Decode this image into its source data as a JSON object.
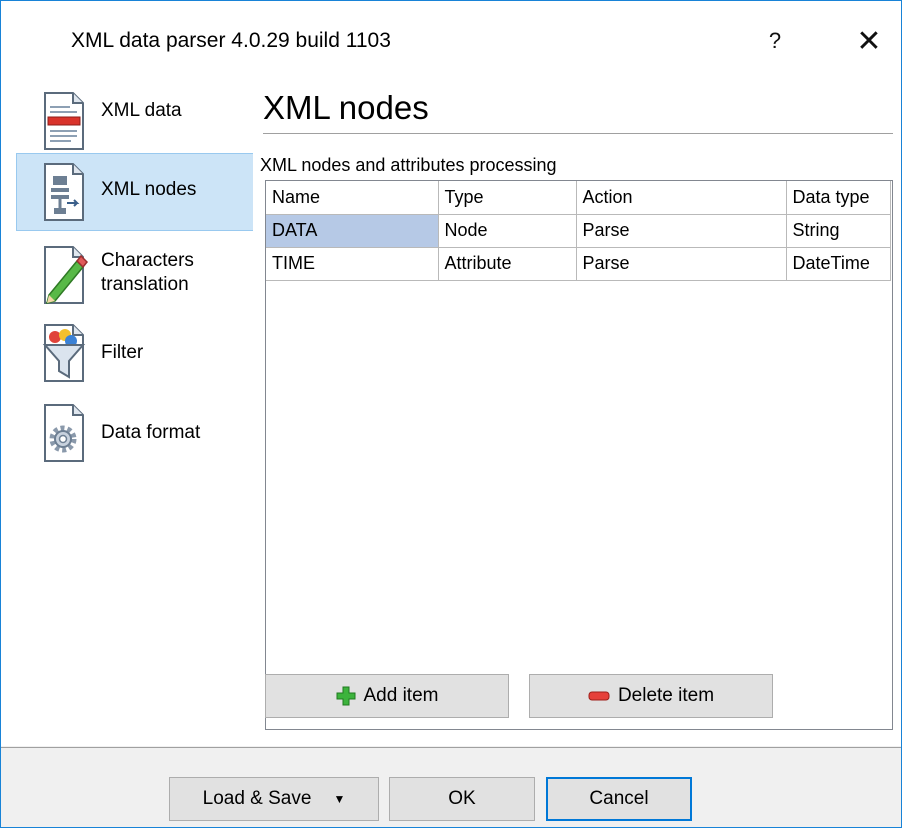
{
  "window": {
    "title": "XML data parser 4.0.29 build 1103",
    "help_label": "?",
    "close_label": "✕"
  },
  "sidebar": {
    "items": [
      {
        "label": "XML data",
        "icon": "document-icon",
        "active": false
      },
      {
        "label": "XML nodes",
        "icon": "xml-nodes-icon",
        "active": true
      },
      {
        "label_line1": "Characters",
        "label_line2": "translation",
        "icon": "pencil-document-icon",
        "active": false
      },
      {
        "label": "Filter",
        "icon": "funnel-icon",
        "active": false
      },
      {
        "label": "Data format",
        "icon": "gear-document-icon",
        "active": false
      }
    ]
  },
  "main": {
    "title": "XML nodes",
    "subtitle": "XML nodes and attributes processing",
    "table": {
      "columns": [
        "Name",
        "Type",
        "Action",
        "Data type"
      ],
      "rows": [
        [
          "DATA",
          "Node",
          "Parse",
          "String"
        ],
        [
          "TIME",
          "Attribute",
          "Parse",
          "DateTime"
        ]
      ],
      "selected_cell": "DATA"
    },
    "add_label": "Add item",
    "delete_label": "Delete item"
  },
  "footer": {
    "load_save_label": "Load & Save",
    "ok_label": "OK",
    "cancel_label": "Cancel"
  },
  "colors": {
    "accent": "#0078d7",
    "selection": "#cce4f7",
    "cell_selection": "#b6c9e6",
    "add_icon": "#2fa92f",
    "delete_icon": "#e03c3c"
  }
}
